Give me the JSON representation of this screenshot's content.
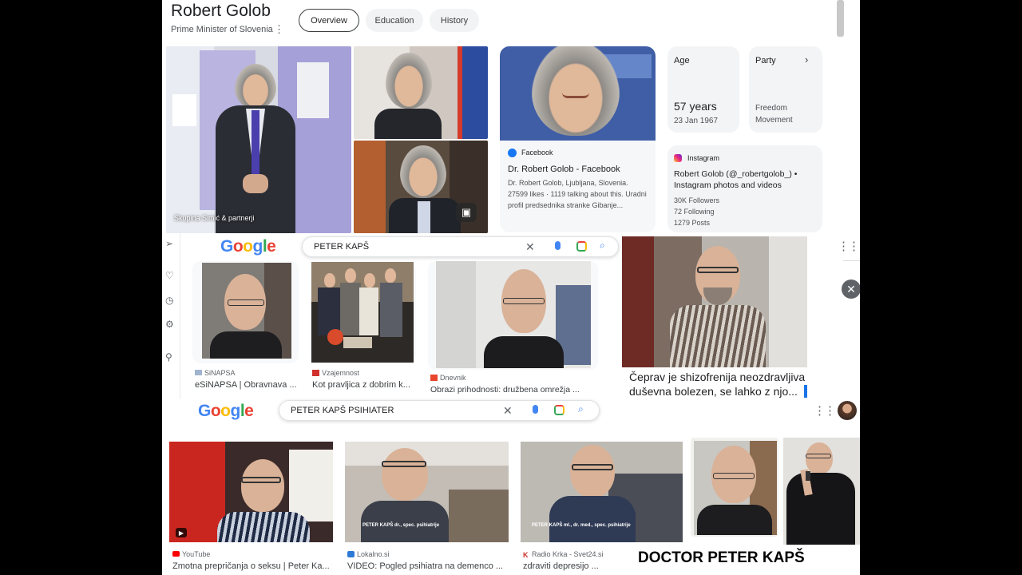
{
  "knowledge_panel": {
    "name": "Robert Golob",
    "subtitle": "Prime Minister of Slovenia",
    "tabs": [
      "Overview",
      "Education",
      "History"
    ],
    "active_tab": "Overview",
    "photo_credit": "Skupina Simić & partnerji",
    "age_card": {
      "label": "Age",
      "value": "57 years",
      "detail": "23 Jan 1967"
    },
    "party_card": {
      "label": "Party",
      "value_line1": "Freedom",
      "value_line2": "Movement"
    },
    "facebook": {
      "source": "Facebook",
      "title": "Dr. Robert Golob - Facebook",
      "line1": "Dr. Robert Golob, Ljubljana, Slovenia.",
      "line2": "27599 likes · 1119 talking about this. Uradni",
      "line3": "profil predsednika stranke Gibanje..."
    },
    "instagram": {
      "source": "Instagram",
      "title_line1": "Robert Golob (@_robertgolob_) •",
      "title_line2": "Instagram photos and videos",
      "followers": "30K Followers",
      "following": "72 Following",
      "posts": "1279 Posts"
    }
  },
  "search1": {
    "logo": "Google",
    "query": "PETER KAPŠ",
    "results": [
      {
        "source": "SiNAPSA",
        "title": "eSiNAPSA | Obravnava ..."
      },
      {
        "source": "Vzajemnost",
        "title": "Kot pravljica z dobrim k..."
      },
      {
        "source": "Dnevnik",
        "title": "Obrazi prihodnosti: družbena omrežja ..."
      }
    ],
    "preview_caption_line1": "Čeprav je shizofrenija neozdravljiva",
    "preview_caption_line2": "duševna bolezen, se lahko z njo..."
  },
  "search2": {
    "logo": "Google",
    "query": "PETER KAPŠ PSIHIATER",
    "results": [
      {
        "source": "YouTube",
        "title": "Zmotna prepričanja o seksu | Peter Ka..."
      },
      {
        "source": "Lokalno.si",
        "title": "VIDEO: Pogled psihiatra na demenco ..."
      },
      {
        "source": "Radio Krka - Svet24.si",
        "title": "zdraviti depresijo ..."
      }
    ],
    "lower_third_1": "PETER KAPŠ dr., spec. psihiatrije",
    "lower_third_2": "PETER KAPŠ ml., dr. med., spec. psihiatrije",
    "overlay_label": "DOCTOR PETER KAPŠ"
  },
  "colors": {
    "google_blue": "#4285f4",
    "google_red": "#ea4335",
    "google_yellow": "#fbbc05",
    "google_green": "#34a853",
    "facebook": "#1877f2",
    "instagram": "#e1306c",
    "youtube": "#ff0000"
  },
  "icons": [
    "more-vert-icon",
    "chevron-right-icon",
    "image-search-icon",
    "close-icon",
    "mic-icon",
    "lens-icon",
    "search-icon",
    "apps-grid-icon",
    "send-icon",
    "heart-icon",
    "clock-icon",
    "gear-icon",
    "location-icon",
    "play-icon"
  ]
}
